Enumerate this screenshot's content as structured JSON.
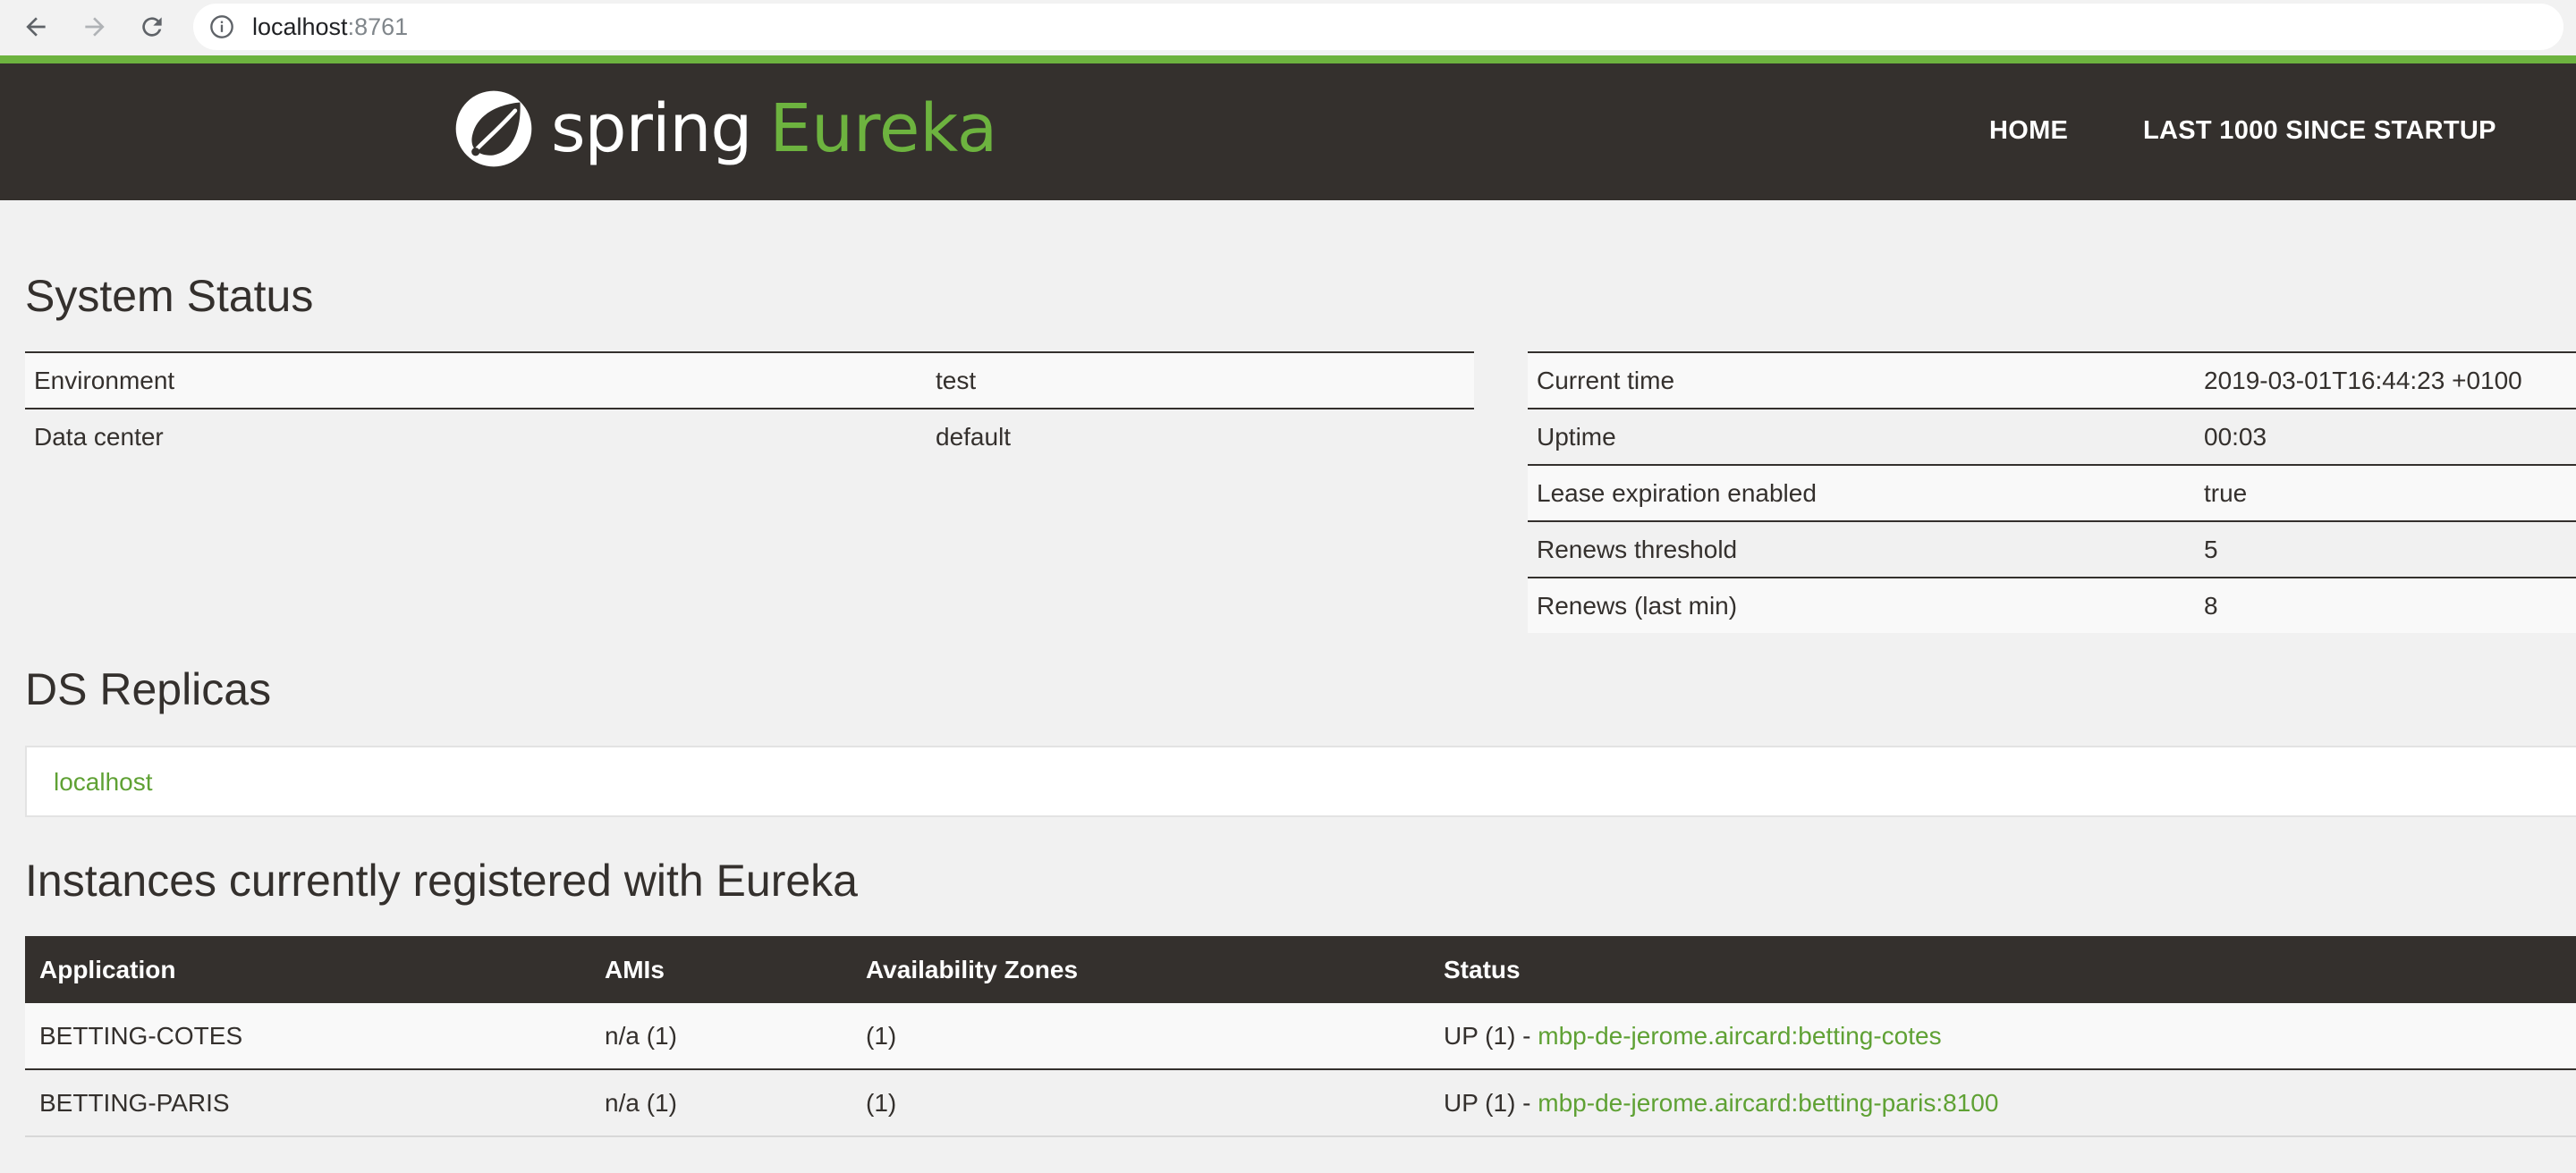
{
  "browser": {
    "url_host": "localhost",
    "url_port": ":8761"
  },
  "header": {
    "logo_spring": "spring",
    "logo_eureka": "Eureka",
    "nav": [
      {
        "label": "HOME"
      },
      {
        "label": "LAST 1000 SINCE STARTUP"
      }
    ]
  },
  "system_status": {
    "title": "System Status",
    "left": [
      {
        "key": "Environment",
        "value": "test"
      },
      {
        "key": "Data center",
        "value": "default"
      }
    ],
    "right": [
      {
        "key": "Current time",
        "value": "2019-03-01T16:44:23 +0100"
      },
      {
        "key": "Uptime",
        "value": "00:03"
      },
      {
        "key": "Lease expiration enabled",
        "value": "true"
      },
      {
        "key": "Renews threshold",
        "value": "5"
      },
      {
        "key": "Renews (last min)",
        "value": "8"
      }
    ]
  },
  "ds_replicas": {
    "title": "DS Replicas",
    "items": [
      {
        "label": "localhost"
      }
    ]
  },
  "instances": {
    "title": "Instances currently registered with Eureka",
    "columns": [
      "Application",
      "AMIs",
      "Availability Zones",
      "Status"
    ],
    "rows": [
      {
        "application": "BETTING-COTES",
        "amis": "n/a (1)",
        "zones": "(1)",
        "status_prefix": "UP (1) - ",
        "status_link": "mbp-de-jerome.aircard:betting-cotes"
      },
      {
        "application": "BETTING-PARIS",
        "amis": "n/a (1)",
        "zones": "(1)",
        "status_prefix": "UP (1) - ",
        "status_link": "mbp-de-jerome.aircard:betting-paris:8100"
      }
    ]
  },
  "colors": {
    "brand_green": "#6db33f",
    "header_dark": "#34302d",
    "background": "#f1f1f1"
  }
}
